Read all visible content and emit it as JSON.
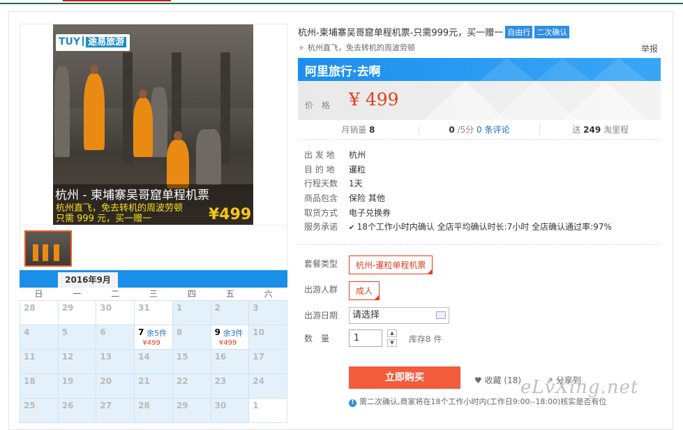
{
  "gallery": {
    "logo_text": "TUY",
    "logo_brand": "途易旅游",
    "caption_title": "杭州 - 柬埔寨吴哥窟单程机票",
    "caption_line1": "杭州直飞，免去转机的周波劳顿",
    "caption_line2": "只需 999 元，买一赠一",
    "caption_price": "¥499"
  },
  "calendar": {
    "month": "2016年9月",
    "weekdays": [
      "日",
      "一",
      "二",
      "三",
      "四",
      "五",
      "六"
    ],
    "rows": [
      [
        {
          "d": "28",
          "other": true
        },
        {
          "d": "29",
          "other": true
        },
        {
          "d": "30",
          "other": true
        },
        {
          "d": "31",
          "other": true
        },
        {
          "d": "1"
        },
        {
          "d": "2"
        },
        {
          "d": "3"
        }
      ],
      [
        {
          "d": "4"
        },
        {
          "d": "5"
        },
        {
          "d": "6"
        },
        {
          "d": "7",
          "avail": true,
          "rem": "余5件",
          "price": "¥499"
        },
        {
          "d": "8"
        },
        {
          "d": "9",
          "avail": true,
          "rem": "余3件",
          "price": "¥499"
        },
        {
          "d": "10"
        }
      ],
      [
        {
          "d": "11"
        },
        {
          "d": "12"
        },
        {
          "d": "13"
        },
        {
          "d": "14"
        },
        {
          "d": "15"
        },
        {
          "d": "16"
        },
        {
          "d": "17"
        }
      ],
      [
        {
          "d": "18"
        },
        {
          "d": "19"
        },
        {
          "d": "20"
        },
        {
          "d": "21"
        },
        {
          "d": "22"
        },
        {
          "d": "23"
        },
        {
          "d": "24"
        }
      ],
      [
        {
          "d": "25"
        },
        {
          "d": "26"
        },
        {
          "d": "27"
        },
        {
          "d": "28"
        },
        {
          "d": "29"
        },
        {
          "d": "30"
        },
        {
          "d": "1",
          "other": true
        }
      ]
    ]
  },
  "product": {
    "title": "杭州-柬埔寨吴哥窟单程机票-只需999元，买一赠一",
    "tag1": "自由行",
    "tag2": "二次确认",
    "subtitle": "杭州直飞，免去转机的周波劳顿",
    "report": "举报",
    "banner": "阿里旅行·去啊",
    "price_label": "价　格",
    "price_value": "¥ 499",
    "sales_label": "月销量",
    "sales_value": "8",
    "rating_value": "0",
    "rating_suffix": "/5分",
    "reviews": "0 条评论",
    "points_prefix": "送",
    "points_value": "249",
    "points_suffix": "淘里程"
  },
  "info": [
    {
      "k": "出 发 地",
      "v": "杭州"
    },
    {
      "k": "目 的 地",
      "v": "暹粒"
    },
    {
      "k": "行程天数",
      "v": "1天"
    },
    {
      "k": "商品包含",
      "v": "保险  其他"
    },
    {
      "k": "取货方式",
      "v": "电子兑换券"
    },
    {
      "k": "服务承诺",
      "v": "18个工作小时内确认    全店平均确认时长:7小时    全店确认通过率:97%"
    }
  ],
  "options": {
    "package_label": "套餐类型",
    "package_value": "杭州-暹粒单程机票",
    "group_label": "出游人群",
    "group_value": "成人",
    "date_label": "出游日期",
    "date_placeholder": "请选择",
    "qty_label": "数　量",
    "qty_value": "1",
    "stock": "库存8 件",
    "buy": "立即购买",
    "fav": "收藏 (18)",
    "share": "分享到",
    "notice": "需二次确认,商家将在18个工作小时内(工作日9:00--18:00)核实是否有位"
  },
  "watermark": "eLvXing.net"
}
